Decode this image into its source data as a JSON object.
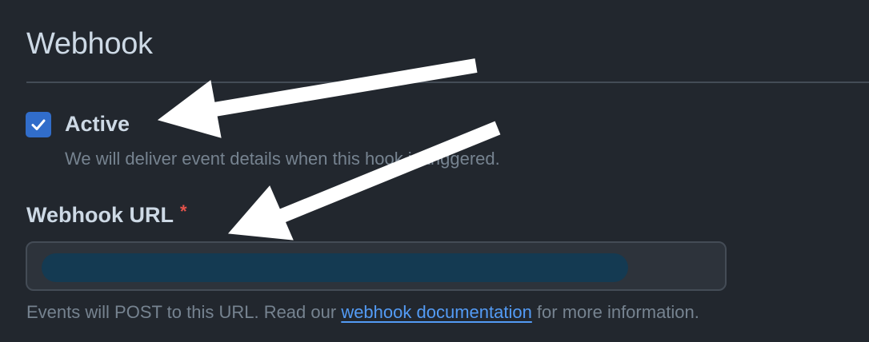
{
  "section": {
    "title": "Webhook"
  },
  "active": {
    "label": "Active",
    "checked": true,
    "help": "We will deliver event details when this hook is triggered."
  },
  "webhook_url": {
    "label": "Webhook URL",
    "required_marker": "*",
    "value_redacted": true,
    "help_before": "Events will POST to this URL. Read our ",
    "help_link": "webhook documentation",
    "help_after": " for more information."
  },
  "annotations": {
    "arrow_color": "#ffffff",
    "targets": [
      "Active",
      "Webhook URL"
    ]
  },
  "colors": {
    "background": "#22272e",
    "accent": "#316dca",
    "link": "#539bf5",
    "required": "#e5534b"
  }
}
